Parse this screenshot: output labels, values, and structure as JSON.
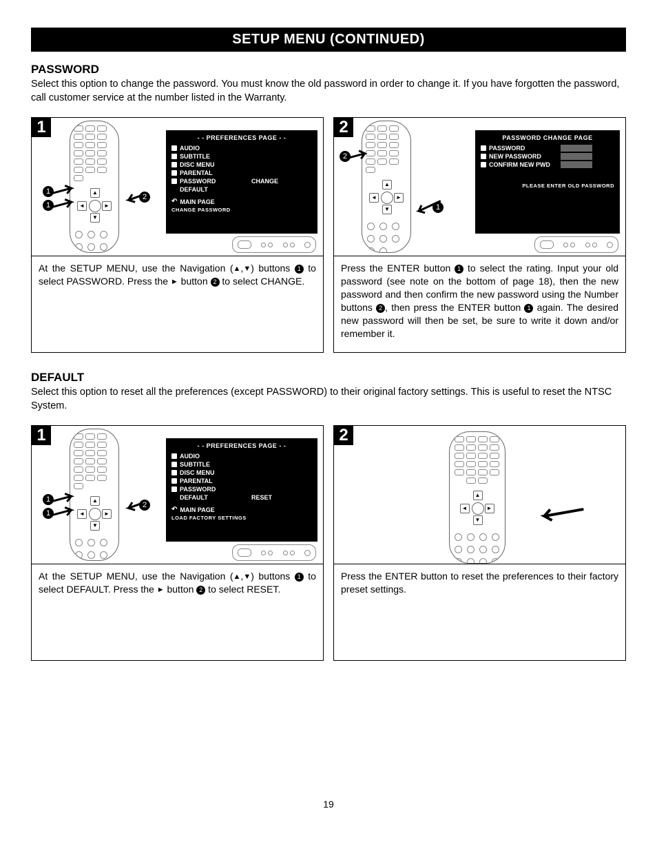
{
  "page_title": "SETUP MENU (CONTINUED)",
  "page_number": "19",
  "sections": {
    "password": {
      "heading": "PASSWORD",
      "desc": "Select this option to change the password. You must know the old password in order to change it. If you have forgotten the password, call customer service at the number listed in the Warranty.",
      "step1_num": "1",
      "step2_num": "2",
      "step1_text_a": "At the SETUP MENU, use the Navigation (",
      "step1_text_b": ") buttons ",
      "step1_text_c": " to select PASSWORD. Press the ",
      "step1_text_d": " button ",
      "step1_text_e": " to select CHANGE.",
      "step2_text_a": "Press the ENTER button ",
      "step2_text_b": " to select the rating. Input your old password (see note on the bottom of page 18), then the new password and then confirm the new password using the Number buttons ",
      "step2_text_c": ", then press the ENTER button ",
      "step2_text_d": " again. The desired new password will then be set, be sure to write it down and/or remember it.",
      "screen1": {
        "title": "- - PREFERENCES PAGE - -",
        "items": [
          "AUDIO",
          "SUBTITLE",
          "DISC MENU",
          "PARENTAL",
          "PASSWORD",
          "DEFAULT"
        ],
        "selected_value": "CHANGE",
        "main_page": "MAIN PAGE",
        "status": "CHANGE PASSWORD"
      },
      "screen2": {
        "title": "PASSWORD CHANGE PAGE",
        "rows": [
          "PASSWORD",
          "NEW PASSWORD",
          "CONFIRM NEW PWD"
        ],
        "status": "PLEASE ENTER OLD PASSWORD"
      }
    },
    "default": {
      "heading": "DEFAULT",
      "desc": "Select this option to reset all the preferences (except PASSWORD) to their original factory settings. This is useful to reset the NTSC System.",
      "step1_num": "1",
      "step2_num": "2",
      "step1_text_a": "At the SETUP MENU, use the Navigation (",
      "step1_text_b": ") buttons ",
      "step1_text_c": " to select DEFAULT. Press the ",
      "step1_text_d": " button ",
      "step1_text_e": " to select RESET.",
      "step2_text": "Press the ENTER button to reset the preferences to their factory preset settings.",
      "screen1": {
        "title": "- - PREFERENCES PAGE - -",
        "items": [
          "AUDIO",
          "SUBTITLE",
          "DISC MENU",
          "PARENTAL",
          "PASSWORD",
          "DEFAULT"
        ],
        "selected_value": "RESET",
        "main_page": "MAIN PAGE",
        "status": "LOAD FACTORY SETTINGS"
      }
    }
  },
  "glyphs": {
    "tri_up": "▲",
    "tri_down": "▼",
    "tri_right": "►",
    "comma": ",",
    "circ1": "1",
    "circ2": "2"
  }
}
